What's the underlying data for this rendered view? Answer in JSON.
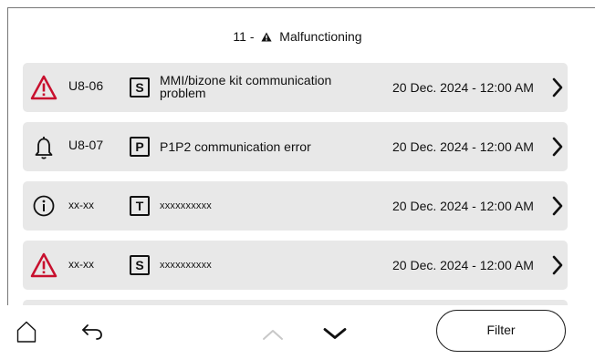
{
  "header": {
    "prefix": "11 -",
    "title": "Malfunctioning"
  },
  "colors": {
    "error": "#c8102e",
    "row_bg": "#e8e8e8"
  },
  "items": [
    {
      "type_icon": "warning-triangle-icon",
      "code": "U8-06",
      "category": "S",
      "description": "MMI/bizone kit communication problem",
      "date": "20 Dec. 2024 - 12:00 AM"
    },
    {
      "type_icon": "bell-icon",
      "code": "U8-07",
      "category": "P",
      "description": "P1P2 communication error",
      "date": "20 Dec. 2024 - 12:00 AM"
    },
    {
      "type_icon": "info-icon",
      "code": "xx-xx",
      "category": "T",
      "description": "xxxxxxxxxx",
      "date": "20 Dec. 2024 - 12:00 AM"
    },
    {
      "type_icon": "warning-triangle-icon",
      "code": "xx-xx",
      "category": "S",
      "description": "xxxxxxxxxx",
      "date": "20 Dec. 2024 - 12:00 AM"
    }
  ],
  "footer": {
    "filter_label": "Filter"
  }
}
